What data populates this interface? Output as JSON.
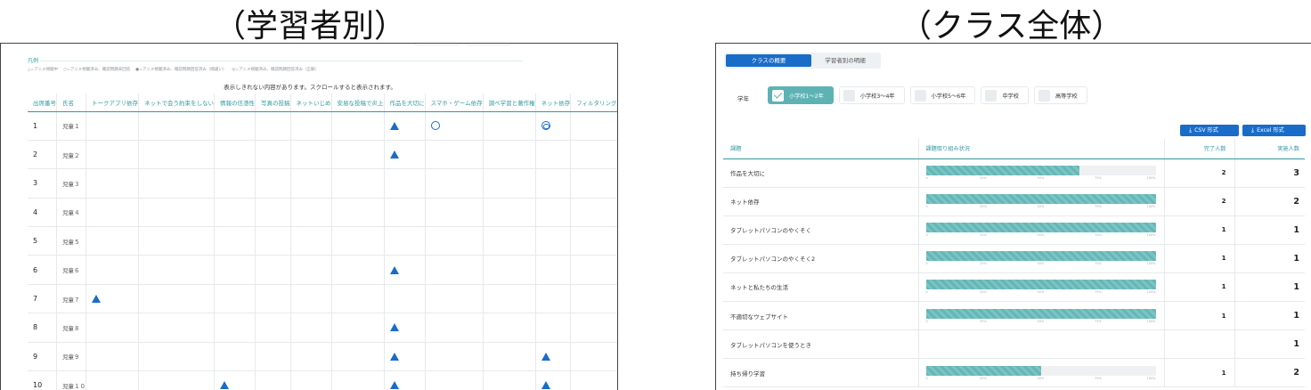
{
  "captions": {
    "left": "（学習者別）",
    "right": "（クラス全体）"
  },
  "left": {
    "legend_title": "凡例",
    "legend_items": [
      "△=アニメ視聴中",
      "○=アニメ視聴済み、確認問題未回答",
      "●=アニメ視聴済み、確認問題回答済み（間違い）",
      "◎=アニメ視聴済み、確認問題回答済み（正解）"
    ],
    "hint": "表示しきれない内容があります。スクロールすると表示されます。",
    "headers": [
      "出席番号",
      "氏名",
      "トークアプリ依存",
      "ネットで会う約束をしない",
      "情報の信憑性",
      "写真の投稿",
      "ネットいじめ",
      "安易な投稿で炎上",
      "作品を大切に",
      "スマホ・ゲーム依存",
      "調べ学習と著作権",
      "ネット依存",
      "フィルタリング"
    ],
    "rows": [
      {
        "no": "1",
        "name": "児童１",
        "marks": {
          "6": "tri",
          "7": "circle",
          "9": "dcircle"
        }
      },
      {
        "no": "2",
        "name": "児童２",
        "marks": {
          "6": "tri"
        }
      },
      {
        "no": "3",
        "name": "児童３",
        "marks": {}
      },
      {
        "no": "4",
        "name": "児童４",
        "marks": {}
      },
      {
        "no": "5",
        "name": "児童５",
        "marks": {}
      },
      {
        "no": "6",
        "name": "児童６",
        "marks": {
          "6": "tri"
        }
      },
      {
        "no": "7",
        "name": "児童７",
        "marks": {
          "0": "tri"
        }
      },
      {
        "no": "8",
        "name": "児童８",
        "marks": {
          "6": "tri"
        }
      },
      {
        "no": "9",
        "name": "児童９",
        "marks": {
          "6": "tri",
          "9": "tri"
        }
      },
      {
        "no": "10",
        "name": "児童１０",
        "marks": {
          "2": "tri",
          "6": "tri",
          "9": "tri"
        }
      }
    ]
  },
  "right": {
    "tabs": {
      "active": "クラスの概要",
      "inactive": "学習者別の明細"
    },
    "grade_label": "学年",
    "grades": [
      {
        "label": "小学校1～2年",
        "selected": true
      },
      {
        "label": "小学校3～4年",
        "selected": false
      },
      {
        "label": "小学校5～6年",
        "selected": false
      },
      {
        "label": "中学校",
        "selected": false
      },
      {
        "label": "高等学校",
        "selected": false
      }
    ],
    "buttons": {
      "csv": "CSV 形式",
      "excel": "Excel 形式"
    },
    "headers": {
      "task": "課題",
      "progress": "課題取り組み状況",
      "done": "完了人数",
      "total": "実施人数"
    },
    "tick_labels": [
      "0",
      "25%",
      "50%",
      "75%",
      "100%"
    ],
    "rows": [
      {
        "task": "作品を大切に",
        "progress": 0.67,
        "done": "2",
        "total": "3"
      },
      {
        "task": "ネット依存",
        "progress": 1.0,
        "done": "2",
        "total": "2"
      },
      {
        "task": "タブレットパソコンのやくそく",
        "progress": 1.0,
        "done": "1",
        "total": "1"
      },
      {
        "task": "タブレットパソコンのやくそく2",
        "progress": 1.0,
        "done": "1",
        "total": "1"
      },
      {
        "task": "ネットと私たちの生活",
        "progress": 1.0,
        "done": "1",
        "total": "1"
      },
      {
        "task": "不適切なウェブサイト",
        "progress": 1.0,
        "done": "1",
        "total": "1"
      },
      {
        "task": "タブレットパソコンを使うとき",
        "progress": null,
        "done": "",
        "total": "1"
      },
      {
        "task": "持ち帰り学習",
        "progress": 0.5,
        "done": "1",
        "total": "2"
      }
    ]
  }
}
